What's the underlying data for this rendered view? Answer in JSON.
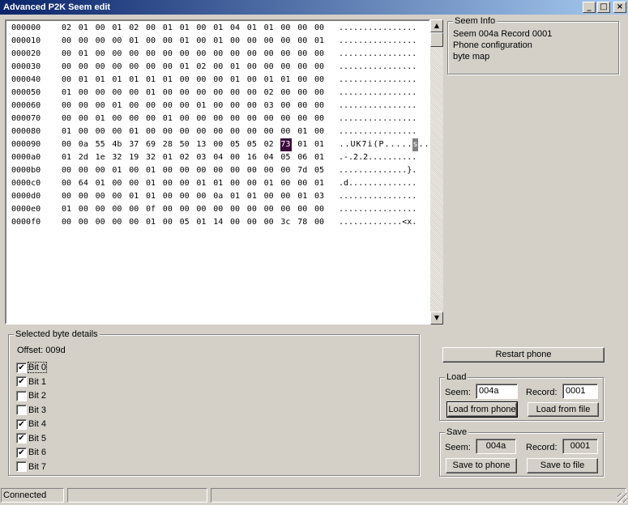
{
  "window": {
    "title": "Advanced P2K Seem edit",
    "buttons": {
      "minimize": "_",
      "maximize": "□",
      "close": "×"
    }
  },
  "hex": {
    "rows": [
      {
        "offset": "000000",
        "bytes": [
          "02",
          "01",
          "00",
          "01",
          "02",
          "00",
          "01",
          "01",
          "00",
          "01",
          "04",
          "01",
          "01",
          "00",
          "00",
          "00"
        ],
        "ascii": "................"
      },
      {
        "offset": "000010",
        "bytes": [
          "00",
          "00",
          "00",
          "00",
          "01",
          "00",
          "00",
          "01",
          "00",
          "01",
          "00",
          "00",
          "00",
          "00",
          "00",
          "01"
        ],
        "ascii": "................"
      },
      {
        "offset": "000020",
        "bytes": [
          "00",
          "01",
          "00",
          "00",
          "00",
          "00",
          "00",
          "00",
          "00",
          "00",
          "00",
          "00",
          "00",
          "00",
          "00",
          "00"
        ],
        "ascii": "................"
      },
      {
        "offset": "000030",
        "bytes": [
          "00",
          "00",
          "00",
          "00",
          "00",
          "00",
          "00",
          "01",
          "02",
          "00",
          "01",
          "00",
          "00",
          "00",
          "00",
          "00"
        ],
        "ascii": "................"
      },
      {
        "offset": "000040",
        "bytes": [
          "00",
          "01",
          "01",
          "01",
          "01",
          "01",
          "01",
          "00",
          "00",
          "00",
          "01",
          "00",
          "01",
          "01",
          "00",
          "00"
        ],
        "ascii": "................"
      },
      {
        "offset": "000050",
        "bytes": [
          "01",
          "00",
          "00",
          "00",
          "00",
          "01",
          "00",
          "00",
          "00",
          "00",
          "00",
          "00",
          "02",
          "00",
          "00",
          "00"
        ],
        "ascii": "................"
      },
      {
        "offset": "000060",
        "bytes": [
          "00",
          "00",
          "00",
          "01",
          "00",
          "00",
          "00",
          "00",
          "01",
          "00",
          "00",
          "00",
          "03",
          "00",
          "00",
          "00"
        ],
        "ascii": "................"
      },
      {
        "offset": "000070",
        "bytes": [
          "00",
          "00",
          "01",
          "00",
          "00",
          "00",
          "01",
          "00",
          "00",
          "00",
          "00",
          "00",
          "00",
          "00",
          "00",
          "00"
        ],
        "ascii": "................"
      },
      {
        "offset": "000080",
        "bytes": [
          "01",
          "00",
          "00",
          "00",
          "01",
          "00",
          "00",
          "00",
          "00",
          "00",
          "00",
          "00",
          "00",
          "00",
          "01",
          "00"
        ],
        "ascii": "................"
      },
      {
        "offset": "000090",
        "bytes": [
          "00",
          "0a",
          "55",
          "4b",
          "37",
          "69",
          "28",
          "50",
          "13",
          "00",
          "05",
          "05",
          "02",
          "73",
          "01",
          "01"
        ],
        "ascii": "..UK7i(P.....s..",
        "selected": 13
      },
      {
        "offset": "0000a0",
        "bytes": [
          "01",
          "2d",
          "1e",
          "32",
          "19",
          "32",
          "01",
          "02",
          "03",
          "04",
          "00",
          "16",
          "04",
          "05",
          "06",
          "01"
        ],
        "ascii": ".-.2.2.........."
      },
      {
        "offset": "0000b0",
        "bytes": [
          "00",
          "00",
          "00",
          "01",
          "00",
          "01",
          "00",
          "00",
          "00",
          "00",
          "00",
          "00",
          "00",
          "00",
          "7d",
          "05"
        ],
        "ascii": "..............}."
      },
      {
        "offset": "0000c0",
        "bytes": [
          "00",
          "64",
          "01",
          "00",
          "00",
          "01",
          "00",
          "00",
          "01",
          "01",
          "00",
          "00",
          "01",
          "00",
          "00",
          "01"
        ],
        "ascii": ".d.............."
      },
      {
        "offset": "0000d0",
        "bytes": [
          "00",
          "00",
          "00",
          "00",
          "01",
          "01",
          "00",
          "00",
          "00",
          "0a",
          "01",
          "01",
          "00",
          "00",
          "01",
          "03"
        ],
        "ascii": "................"
      },
      {
        "offset": "0000e0",
        "bytes": [
          "01",
          "00",
          "00",
          "00",
          "00",
          "0f",
          "00",
          "00",
          "00",
          "00",
          "00",
          "00",
          "00",
          "00",
          "00",
          "00"
        ],
        "ascii": "................"
      },
      {
        "offset": "0000f0",
        "bytes": [
          "00",
          "00",
          "00",
          "00",
          "00",
          "01",
          "00",
          "05",
          "01",
          "14",
          "00",
          "00",
          "00",
          "3c",
          "78",
          "00"
        ],
        "ascii": ".............<x."
      }
    ]
  },
  "seem_info": {
    "label": "Seem Info",
    "lines": [
      "Seem 004a Record 0001",
      "Phone configuration",
      "byte map"
    ]
  },
  "details": {
    "label": "Selected byte details",
    "offset": "Offset: 009d",
    "bits": [
      {
        "label": "Bit 0",
        "checked": true,
        "focused": true
      },
      {
        "label": "Bit 1",
        "checked": true
      },
      {
        "label": "Bit 2",
        "checked": false
      },
      {
        "label": "Bit 3",
        "checked": false
      },
      {
        "label": "Bit 4",
        "checked": true
      },
      {
        "label": "Bit 5",
        "checked": true
      },
      {
        "label": "Bit 6",
        "checked": true
      },
      {
        "label": "Bit 7",
        "checked": false
      }
    ],
    "check_mark": "✔"
  },
  "restart_label": "Restart phone",
  "load": {
    "label": "Load",
    "seem_label": "Seem:",
    "seem_value": "004a",
    "record_label": "Record:",
    "record_value": "0001",
    "from_phone": "Load from phone",
    "from_file": "Load from file"
  },
  "save": {
    "label": "Save",
    "seem_label": "Seem:",
    "seem_value": "004a",
    "record_label": "Record:",
    "record_value": "0001",
    "to_phone": "Save to phone",
    "to_file": "Save to file"
  },
  "status": {
    "text": "Connected"
  },
  "scroll": {
    "up": "▲",
    "down": "▼"
  }
}
